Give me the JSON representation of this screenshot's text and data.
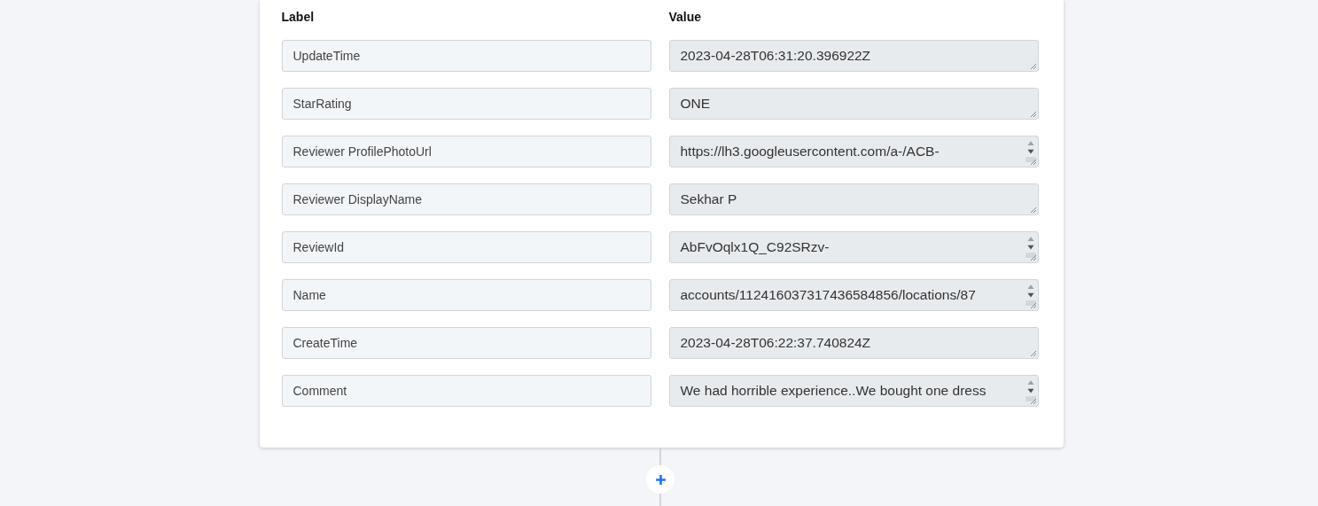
{
  "table": {
    "columns": [
      "Label",
      "Value"
    ],
    "rows": [
      {
        "label": "UpdateTime",
        "value": "2023-04-28T06:31:20.396922Z",
        "scrollable": false
      },
      {
        "label": "StarRating",
        "value": "ONE",
        "scrollable": false
      },
      {
        "label": "Reviewer ProfilePhotoUrl",
        "value": "https://lh3.googleusercontent.com/a-/ACB-",
        "scrollable": true
      },
      {
        "label": "Reviewer DisplayName",
        "value": "Sekhar P",
        "scrollable": false
      },
      {
        "label": "ReviewId",
        "value": "AbFvOqlx1Q_C92SRzv-",
        "scrollable": true
      },
      {
        "label": "Name",
        "value": "accounts/112416037317436584856/locations/87",
        "scrollable": true
      },
      {
        "label": "CreateTime",
        "value": "2023-04-28T06:22:37.740824Z",
        "scrollable": false
      },
      {
        "label": "Comment",
        "value": "We had horrible experience..We bought one dress",
        "scrollable": true
      }
    ]
  }
}
